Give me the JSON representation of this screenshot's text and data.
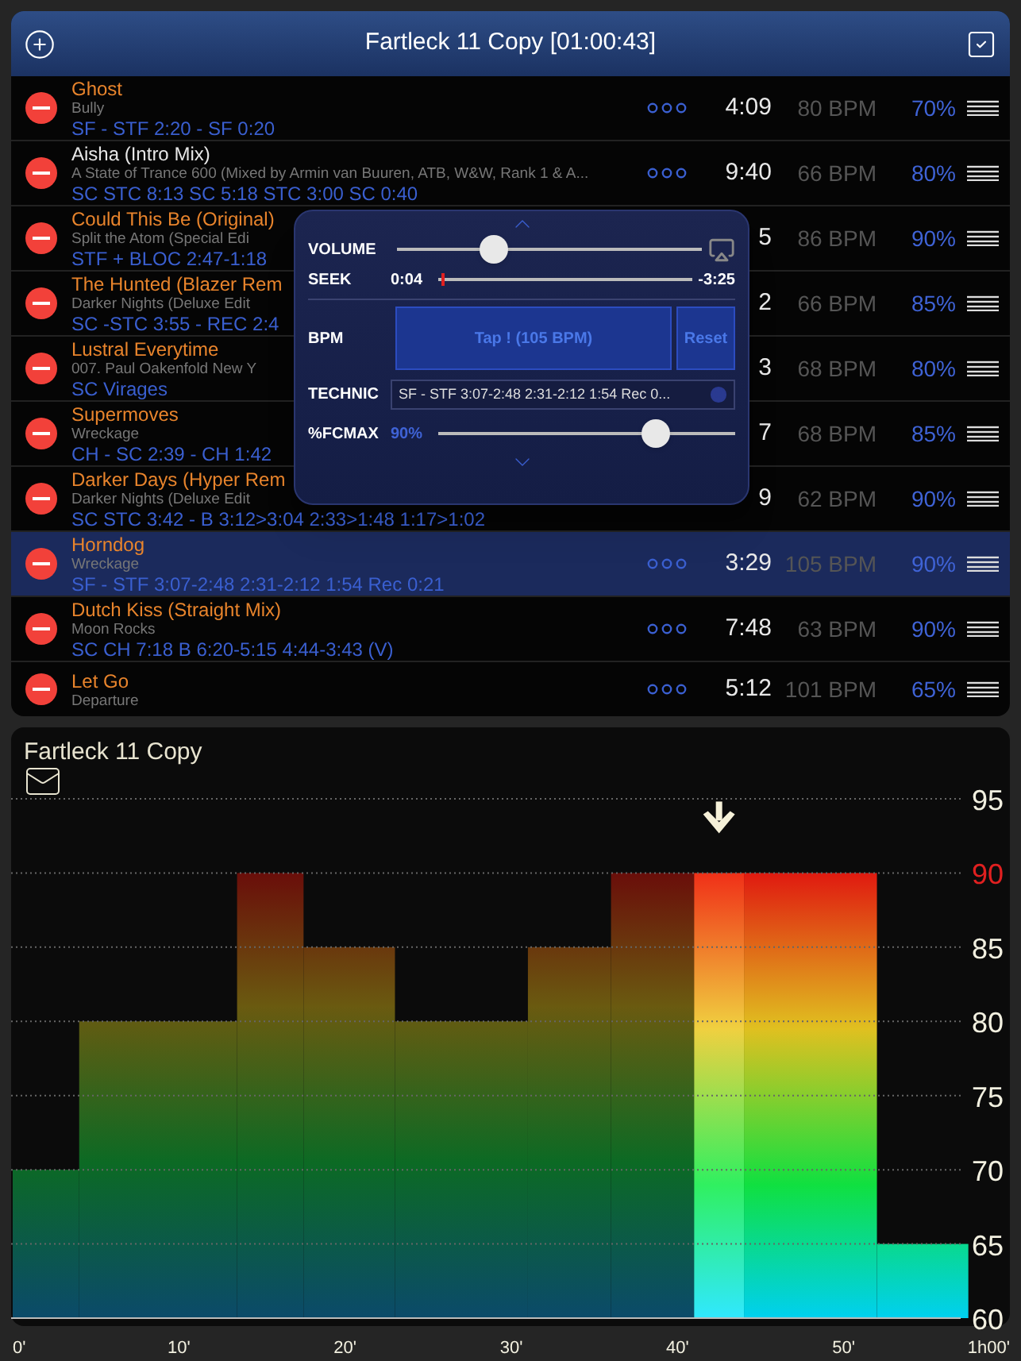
{
  "header": {
    "title": "Fartleck 11 Copy [01:00:43]"
  },
  "tracks": [
    {
      "title": "Ghost",
      "color": "#e8842c",
      "artist": "Bully",
      "technic": "SF - STF 2:20 - SF 0:20",
      "more": true,
      "time": "4:09",
      "bpm": "80 BPM",
      "fcmax": "70%",
      "selected": false
    },
    {
      "title": "Aisha (Intro Mix)",
      "color": "#e6e6e6",
      "artist": "A State of Trance 600 (Mixed by Armin van Buuren, ATB, W&W, Rank 1 & A...",
      "technic": "SC STC 8:13 SC 5:18 STC 3:00 SC 0:40",
      "more": true,
      "time": "9:40",
      "bpm": "66 BPM",
      "fcmax": "80%",
      "selected": false
    },
    {
      "title": "Could This Be (Original)",
      "color": "#e8842c",
      "artist": "Split the Atom (Special Edi",
      "technic": "STF + BLOC 2:47-1:18",
      "more": false,
      "time": "5",
      "bpm": "86 BPM",
      "fcmax": "90%",
      "selected": false
    },
    {
      "title": "The Hunted (Blazer Rem",
      "color": "#e8842c",
      "artist": "Darker Nights (Deluxe Edit",
      "technic": "SC -STC 3:55 - REC 2:4",
      "more": false,
      "time": "2",
      "bpm": "66 BPM",
      "fcmax": "85%",
      "selected": false
    },
    {
      "title": "Lustral Everytime",
      "color": "#e8842c",
      "artist": "007. Paul Oakenfold New Y",
      "technic": "SC Virages",
      "more": false,
      "time": "3",
      "bpm": "68 BPM",
      "fcmax": "80%",
      "selected": false
    },
    {
      "title": "Supermoves",
      "color": "#e8842c",
      "artist": "Wreckage",
      "technic": "CH - SC 2:39 - CH 1:42",
      "more": false,
      "time": "7",
      "bpm": "68 BPM",
      "fcmax": "85%",
      "selected": false
    },
    {
      "title": "Darker Days (Hyper Rem",
      "color": "#e8842c",
      "artist": "Darker Nights (Deluxe Edit",
      "technic": "SC STC 3:42 - B 3:12>3:04 2:33>1:48 1:17>1:02",
      "more": false,
      "time": "9",
      "bpm": "62 BPM",
      "fcmax": "90%",
      "selected": false
    },
    {
      "title": "Horndog",
      "color": "#e8842c",
      "artist": "Wreckage",
      "technic": "SF - STF 3:07-2:48 2:31-2:12 1:54 Rec 0:21",
      "more": true,
      "time": "3:29",
      "bpm": "105 BPM",
      "fcmax": "90%",
      "selected": true
    },
    {
      "title": "Dutch Kiss (Straight Mix)",
      "color": "#e8842c",
      "artist": "Moon Rocks",
      "technic": "SC CH 7:18 B 6:20-5:15 4:44-3:43 (V)",
      "more": true,
      "time": "7:48",
      "bpm": "63 BPM",
      "fcmax": "90%",
      "selected": false
    },
    {
      "title": "Let Go",
      "color": "#e8842c",
      "artist": "Departure",
      "more": true,
      "time": "5:12",
      "bpm": "101 BPM",
      "fcmax": "65%",
      "selected": false
    }
  ],
  "player": {
    "volume": {
      "label": "VOLUME",
      "level": 0.32
    },
    "seek": {
      "label": "SEEK",
      "elapsed": "0:04",
      "remaining": "-3:25",
      "level": 0.01
    },
    "bpm": {
      "label": "BPM",
      "tap": "Tap ! (105 BPM)",
      "reset": "Reset"
    },
    "technic": {
      "label": "TECHNIC",
      "value": "SF - STF 3:07-2:48 2:31-2:12 1:54 Rec 0..."
    },
    "fcmax": {
      "label": "%FCMAX",
      "value": "90%",
      "level": 0.73
    }
  },
  "chart": {
    "title": "Fartleck 11 Copy",
    "segments": [
      {
        "active": false,
        "selected": false
      },
      {
        "active": false,
        "selected": false
      },
      {
        "active": false,
        "selected": false
      },
      {
        "active": false,
        "selected": false
      },
      {
        "active": false,
        "selected": false
      },
      {
        "active": false,
        "selected": false
      },
      {
        "active": false,
        "selected": false
      },
      {
        "active": true,
        "selected": true
      },
      {
        "active": true,
        "selected": false
      },
      {
        "active": true,
        "selected": false
      }
    ],
    "chart_data": {
      "type": "bar",
      "x": [
        2,
        8.75,
        15.5,
        20.25,
        27,
        33.5,
        38.5,
        42.5,
        48,
        54.75
      ],
      "values": [
        70,
        80,
        90,
        85,
        80,
        85,
        90,
        90,
        90,
        65
      ],
      "xlim": [
        0,
        60
      ],
      "ylim": [
        60,
        95
      ],
      "grid": true,
      "yticks": [
        60,
        65,
        70,
        75,
        80,
        85,
        90,
        95
      ],
      "xticks": [
        {
          "value": 0,
          "label": "0'"
        },
        {
          "value": 10,
          "label": "10'"
        },
        {
          "value": 20,
          "label": "20'"
        },
        {
          "value": 30,
          "label": "30'"
        },
        {
          "value": 40,
          "label": "40'"
        },
        {
          "value": 50,
          "label": "50'"
        },
        {
          "value": 60,
          "label": "1h00'"
        }
      ]
    }
  }
}
